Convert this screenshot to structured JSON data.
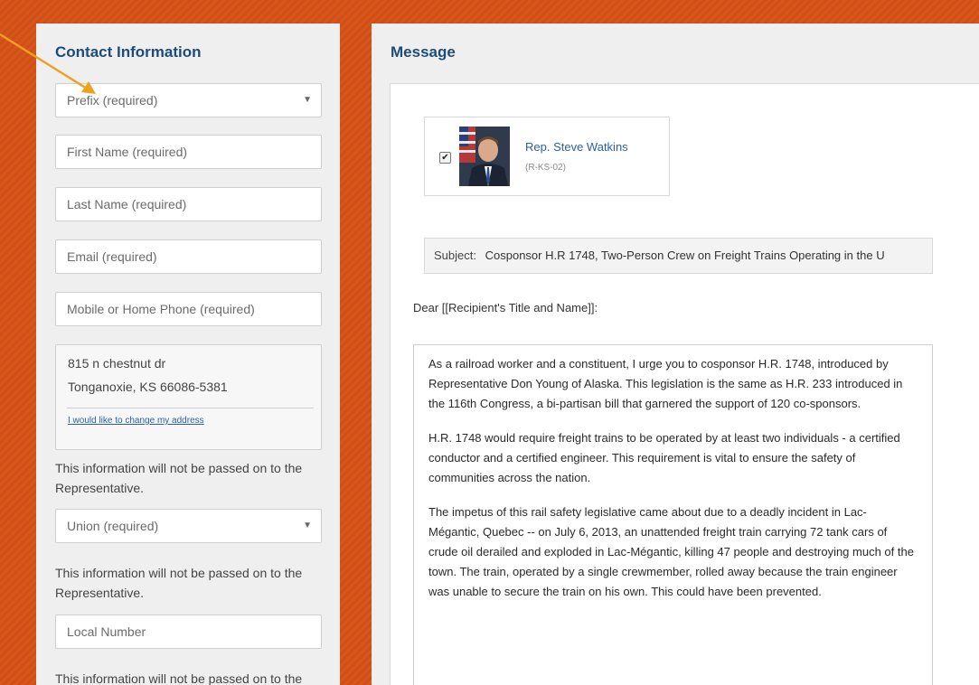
{
  "contact": {
    "heading": "Contact Information",
    "prefix_placeholder": "Prefix (required)",
    "first_name_placeholder": "First Name (required)",
    "last_name_placeholder": "Last Name (required)",
    "email_placeholder": "Email (required)",
    "phone_placeholder": "Mobile or Home Phone (required)",
    "address_line1": "815 n chestnut dr",
    "address_line2": "Tonganoxie, KS 66086-5381",
    "change_address_link": "I would like to change my address",
    "privacy_note_1": "This information will not be passed on to the Representative.",
    "union_placeholder": "Union (required)",
    "privacy_note_2": "This information will not be passed on to the Representative.",
    "local_number_placeholder": "Local Number",
    "privacy_note_3": "This information will not be passed on to the"
  },
  "message": {
    "heading": "Message",
    "recipient": {
      "checked": true,
      "name": "Rep. Steve Watkins",
      "district": "(R-KS-02)"
    },
    "subject_label": "Subject:",
    "subject_value": "Cosponsor H.R 1748, Two-Person Crew on Freight Trains Operating in the U",
    "salutation": "Dear [[Recipient's Title and Name]]:",
    "paragraphs": [
      "As a railroad worker and a constituent, I urge you to cosponsor H.R. 1748, introduced by Representative Don Young of Alaska. This legislation is the same as H.R. 233 introduced in the 116th Congress, a bi-partisan bill that garnered the support of 120 co-sponsors.",
      "H.R. 1748 would require freight trains to be operated by at least two individuals - a certified conductor and a certified engineer. This requirement is vital to ensure the safety of communities across the nation.",
      "The impetus of this rail safety legislative came about due to a deadly incident in Lac-Mégantic, Quebec -- on July 6, 2013, an unattended freight train carrying 72 tank cars of crude oil derailed and exploded in Lac-Mégantic, killing 47 people and destroying much of the town. The train, operated by a single crewmember, rolled away because the train engineer was unable to secure the train on his own. This could have been prevented."
    ]
  },
  "colors": {
    "background": "#d8561b",
    "heading": "#1c4d7a",
    "link": "#2b5fa3",
    "annotation_arrow": "#f0a020"
  },
  "icons": {
    "select_arrow": "▼",
    "checkbox_mark": "✔"
  }
}
